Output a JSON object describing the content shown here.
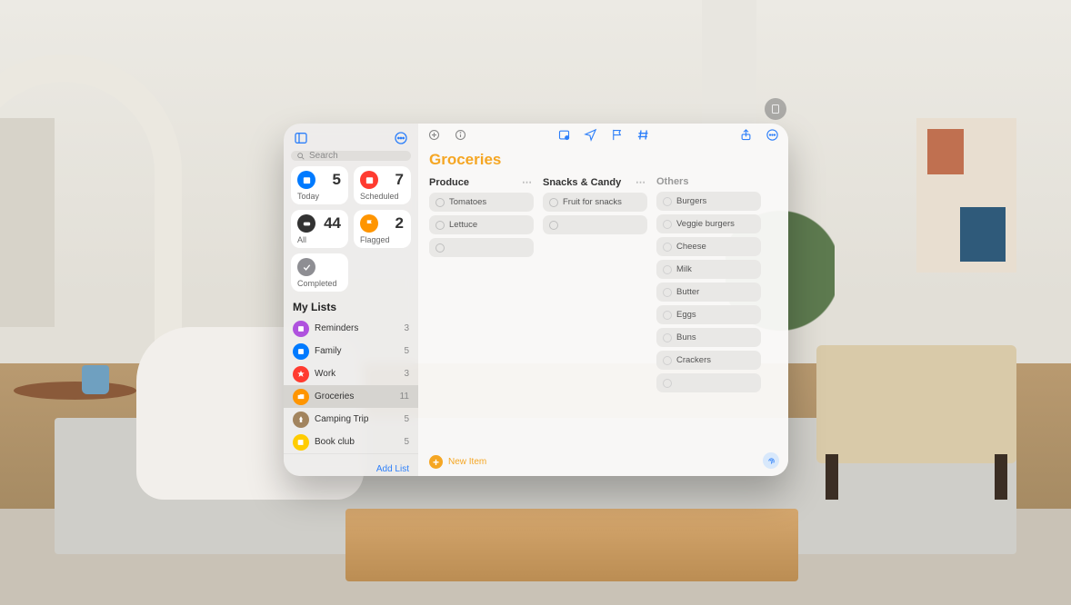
{
  "search": {
    "placeholder": "Search"
  },
  "smart": {
    "today": {
      "label": "Today",
      "count": 5
    },
    "scheduled": {
      "label": "Scheduled",
      "count": 7
    },
    "all": {
      "label": "All",
      "count": 44
    },
    "flagged": {
      "label": "Flagged",
      "count": 2
    },
    "completed": {
      "label": "Completed"
    }
  },
  "myListsHeader": "My Lists",
  "lists": [
    {
      "name": "Reminders",
      "count": 3,
      "color": "purple"
    },
    {
      "name": "Family",
      "count": 5,
      "color": "blue"
    },
    {
      "name": "Work",
      "count": 3,
      "color": "redstar"
    },
    {
      "name": "Groceries",
      "count": 11,
      "color": "orange"
    },
    {
      "name": "Camping Trip",
      "count": 5,
      "color": "brown"
    },
    {
      "name": "Book club",
      "count": 5,
      "color": "gold"
    }
  ],
  "addList": "Add List",
  "listTitle": "Groceries",
  "sections": [
    {
      "name": "Produce",
      "muted": false,
      "more": true,
      "items": [
        "Tomatoes",
        "Lettuce",
        ""
      ]
    },
    {
      "name": "Snacks & Candy",
      "muted": false,
      "more": true,
      "items": [
        "Fruit for snacks",
        ""
      ]
    },
    {
      "name": "Others",
      "muted": true,
      "more": false,
      "items": [
        "Burgers",
        "Veggie burgers",
        "Cheese",
        "Milk",
        "Butter",
        "Eggs",
        "Buns",
        "Crackers",
        ""
      ]
    }
  ],
  "newItem": "New Item"
}
